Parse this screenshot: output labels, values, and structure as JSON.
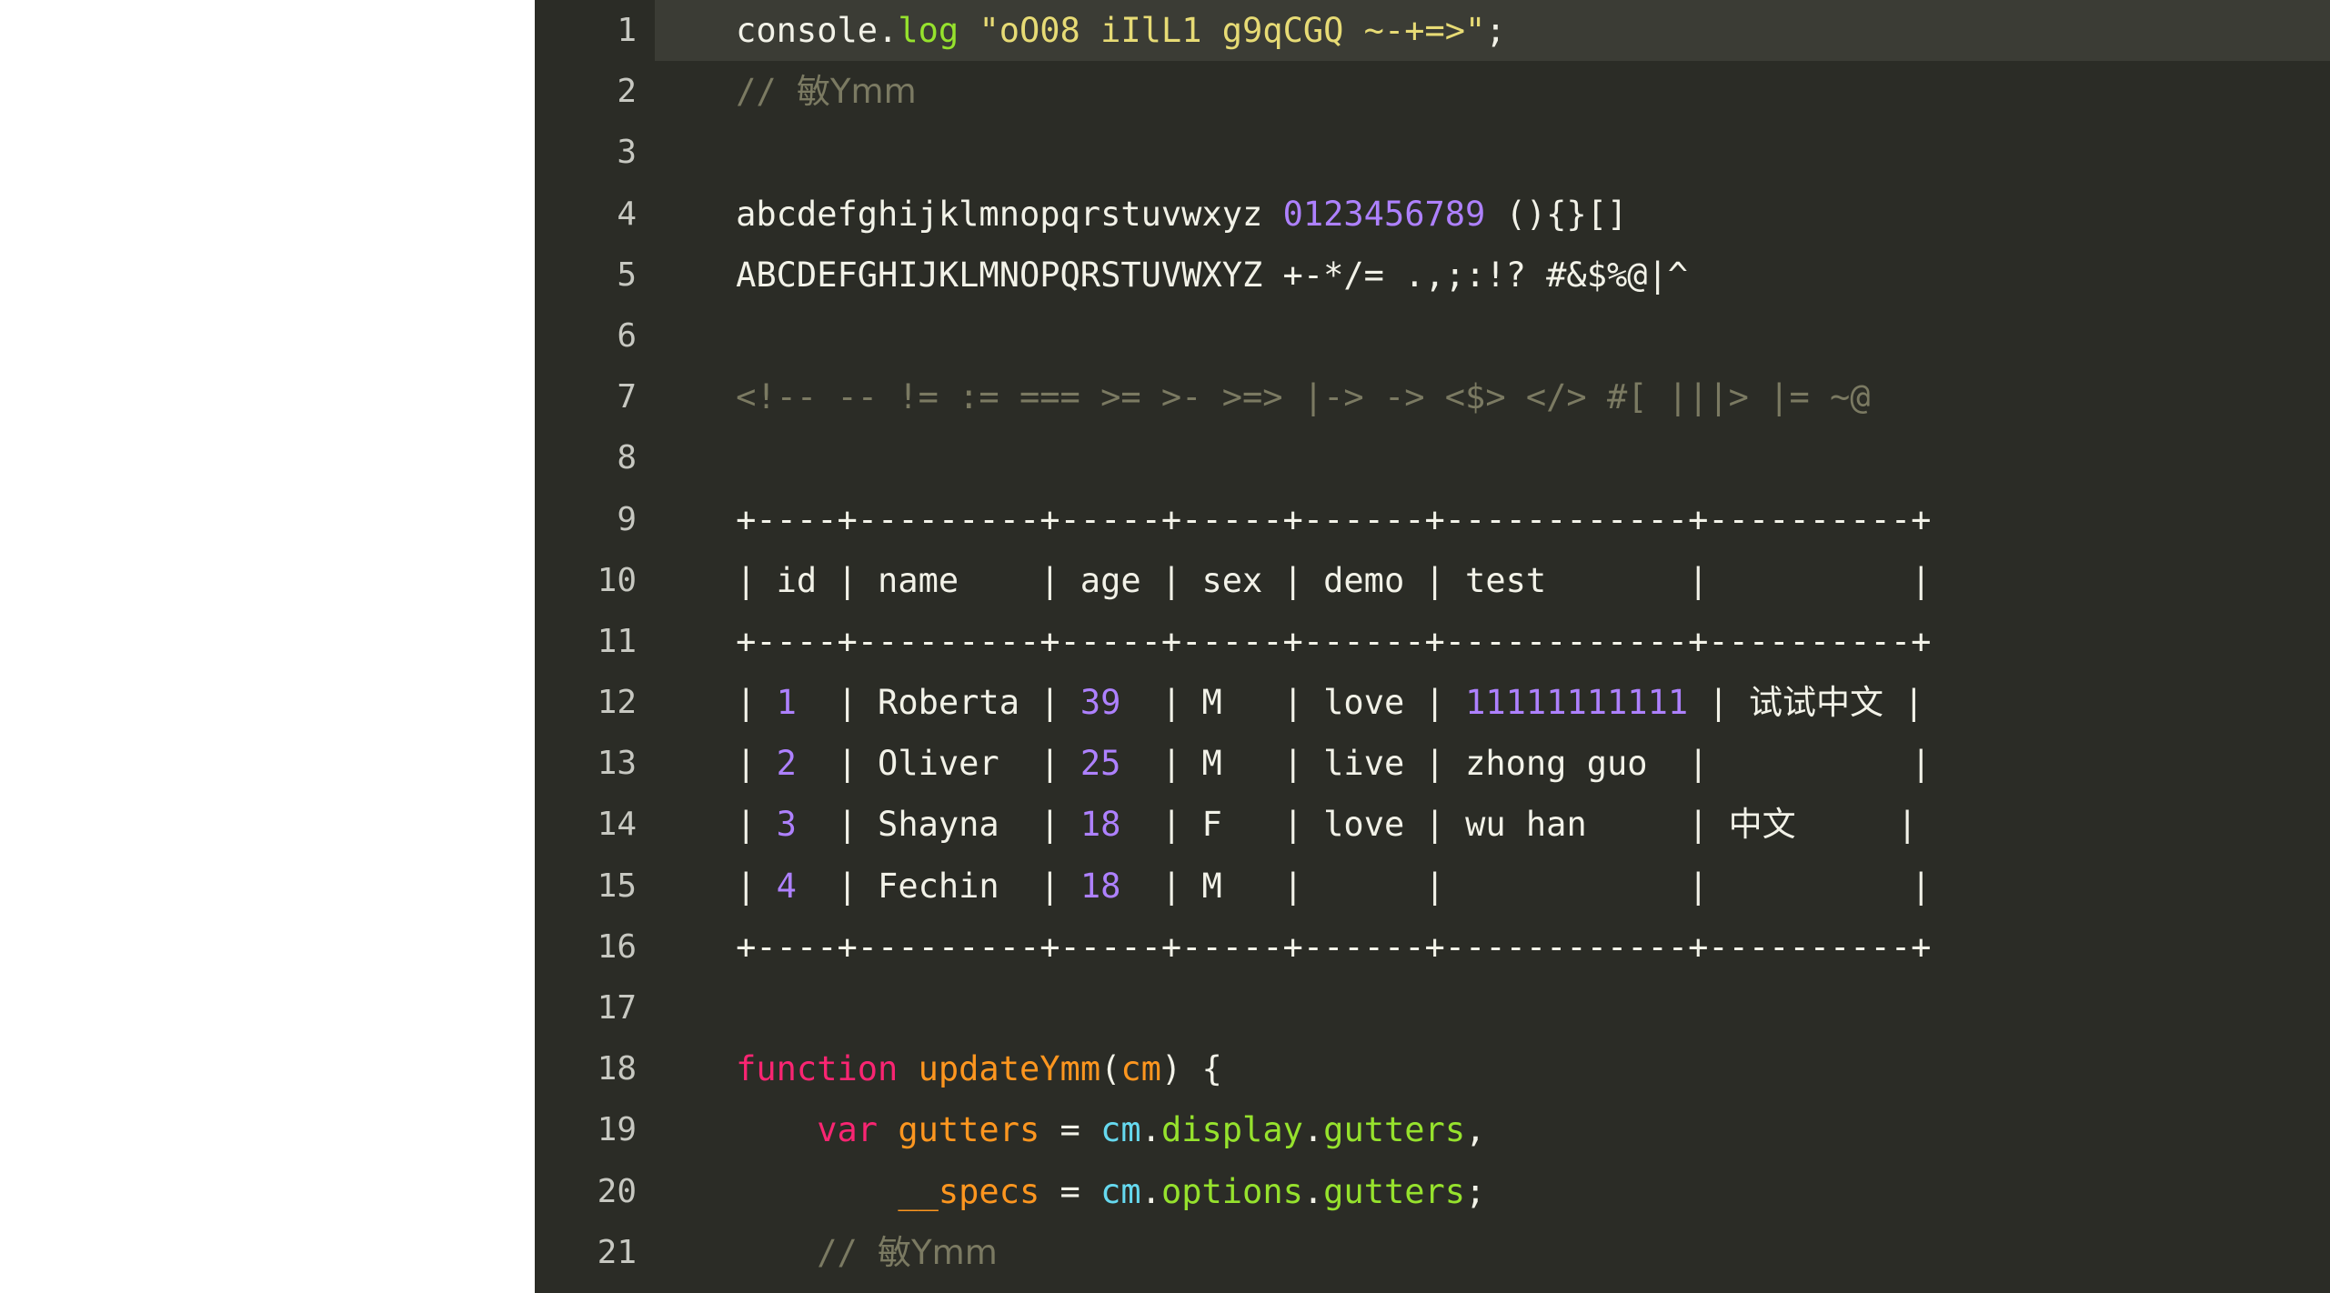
{
  "editor": {
    "theme_name": "monokai-dark",
    "background_color": "#2b2c26",
    "gutter_color": "#c7c8c1",
    "active_line_color": "#3b3c35",
    "foreground_color": "#f2f2e8",
    "accent_colors": {
      "keyword": "#f92572",
      "string": "#e7db75",
      "number": "#ae81ff",
      "property": "#96e22d",
      "function": "#fd961f",
      "parameter": "#66d9ef",
      "comment": "#7b7a62"
    },
    "active_line": 1,
    "total_lines": 21
  },
  "lines": [
    {
      "number": "1",
      "active": true,
      "tokens": [
        {
          "text": "    ",
          "cls": "t-plain"
        },
        {
          "text": "console",
          "cls": "t-plain"
        },
        {
          "text": ".",
          "cls": "t-punct"
        },
        {
          "text": "log",
          "cls": "t-prop"
        },
        {
          "text": " ",
          "cls": "t-plain"
        },
        {
          "text": "\"oO08 iIlL1 g9qCGQ ~-+=>\"",
          "cls": "t-string"
        },
        {
          "text": ";",
          "cls": "t-punct"
        }
      ]
    },
    {
      "number": "2",
      "active": false,
      "tokens": [
        {
          "text": "    ",
          "cls": "t-plain"
        },
        {
          "text": "// ",
          "cls": "t-comment"
        },
        {
          "text": "敏Ymm",
          "cls": "t-comment cjk"
        }
      ]
    },
    {
      "number": "3",
      "active": false,
      "tokens": []
    },
    {
      "number": "4",
      "active": false,
      "tokens": [
        {
          "text": "    ",
          "cls": "t-plain"
        },
        {
          "text": "abcdefghijklmnopqrstuvwxyz ",
          "cls": "t-plain"
        },
        {
          "text": "0123456789",
          "cls": "t-number"
        },
        {
          "text": " (){}[]",
          "cls": "t-plain"
        }
      ]
    },
    {
      "number": "5",
      "active": false,
      "tokens": [
        {
          "text": "    ",
          "cls": "t-plain"
        },
        {
          "text": "ABCDEFGHIJKLMNOPQRSTUVWXYZ +-*/= .,;:!? #&$%@|^",
          "cls": "t-plain"
        }
      ]
    },
    {
      "number": "6",
      "active": false,
      "tokens": []
    },
    {
      "number": "7",
      "active": false,
      "tokens": [
        {
          "text": "    ",
          "cls": "t-plain"
        },
        {
          "text": "<!-- -- != := === >= >- >=> |-> -> <$> </> #[ |||> |= ~@",
          "cls": "t-op"
        }
      ]
    },
    {
      "number": "8",
      "active": false,
      "tokens": []
    },
    {
      "number": "9",
      "active": false,
      "tokens": [
        {
          "text": "    ",
          "cls": "t-plain"
        },
        {
          "text": "+----+---------+-----+-----+------+------------+----------+",
          "cls": "t-plain"
        }
      ]
    },
    {
      "number": "10",
      "active": false,
      "tokens": [
        {
          "text": "    ",
          "cls": "t-plain"
        },
        {
          "text": "| id | name    | age | sex | demo | test       |          |",
          "cls": "t-plain"
        }
      ]
    },
    {
      "number": "11",
      "active": false,
      "tokens": [
        {
          "text": "    ",
          "cls": "t-plain"
        },
        {
          "text": "+----+---------+-----+-----+------+------------+----------+",
          "cls": "t-plain"
        }
      ]
    },
    {
      "number": "12",
      "active": false,
      "tokens": [
        {
          "text": "    ",
          "cls": "t-plain"
        },
        {
          "text": "| ",
          "cls": "t-plain"
        },
        {
          "text": "1",
          "cls": "t-number"
        },
        {
          "text": "  | Roberta | ",
          "cls": "t-plain"
        },
        {
          "text": "39",
          "cls": "t-number"
        },
        {
          "text": "  | M   | love | ",
          "cls": "t-plain"
        },
        {
          "text": "11111111111",
          "cls": "t-number"
        },
        {
          "text": " | ",
          "cls": "t-plain"
        },
        {
          "text": "试试中文",
          "cls": "t-plain cjk"
        },
        {
          "text": " |",
          "cls": "t-plain"
        }
      ]
    },
    {
      "number": "13",
      "active": false,
      "tokens": [
        {
          "text": "    ",
          "cls": "t-plain"
        },
        {
          "text": "| ",
          "cls": "t-plain"
        },
        {
          "text": "2",
          "cls": "t-number"
        },
        {
          "text": "  | Oliver  | ",
          "cls": "t-plain"
        },
        {
          "text": "25",
          "cls": "t-number"
        },
        {
          "text": "  | M   | live | zhong guo  |          |",
          "cls": "t-plain"
        }
      ]
    },
    {
      "number": "14",
      "active": false,
      "tokens": [
        {
          "text": "    ",
          "cls": "t-plain"
        },
        {
          "text": "| ",
          "cls": "t-plain"
        },
        {
          "text": "3",
          "cls": "t-number"
        },
        {
          "text": "  | Shayna  | ",
          "cls": "t-plain"
        },
        {
          "text": "18",
          "cls": "t-number"
        },
        {
          "text": "  | F   | love | wu han     | ",
          "cls": "t-plain"
        },
        {
          "text": "中文",
          "cls": "t-plain cjk"
        },
        {
          "text": "     |",
          "cls": "t-plain"
        }
      ]
    },
    {
      "number": "15",
      "active": false,
      "tokens": [
        {
          "text": "    ",
          "cls": "t-plain"
        },
        {
          "text": "| ",
          "cls": "t-plain"
        },
        {
          "text": "4",
          "cls": "t-number"
        },
        {
          "text": "  | Fechin  | ",
          "cls": "t-plain"
        },
        {
          "text": "18",
          "cls": "t-number"
        },
        {
          "text": "  | M   |      |            |          |",
          "cls": "t-plain"
        }
      ]
    },
    {
      "number": "16",
      "active": false,
      "tokens": [
        {
          "text": "    ",
          "cls": "t-plain"
        },
        {
          "text": "+----+---------+-----+-----+------+------------+----------+",
          "cls": "t-plain"
        }
      ]
    },
    {
      "number": "17",
      "active": false,
      "tokens": []
    },
    {
      "number": "18",
      "active": false,
      "tokens": [
        {
          "text": "    ",
          "cls": "t-plain"
        },
        {
          "text": "function",
          "cls": "t-kw"
        },
        {
          "text": " ",
          "cls": "t-plain"
        },
        {
          "text": "updateYmm",
          "cls": "t-func"
        },
        {
          "text": "(",
          "cls": "t-punct"
        },
        {
          "text": "cm",
          "cls": "t-func"
        },
        {
          "text": ") {",
          "cls": "t-punct"
        }
      ]
    },
    {
      "number": "19",
      "active": false,
      "tokens": [
        {
          "text": "        ",
          "cls": "t-plain"
        },
        {
          "text": "var",
          "cls": "t-kw"
        },
        {
          "text": " ",
          "cls": "t-plain"
        },
        {
          "text": "gutters",
          "cls": "t-var"
        },
        {
          "text": " ",
          "cls": "t-plain"
        },
        {
          "text": "=",
          "cls": "t-punct"
        },
        {
          "text": " ",
          "cls": "t-plain"
        },
        {
          "text": "cm",
          "cls": "t-param"
        },
        {
          "text": ".",
          "cls": "t-punct"
        },
        {
          "text": "display",
          "cls": "t-prop"
        },
        {
          "text": ".",
          "cls": "t-punct"
        },
        {
          "text": "gutters",
          "cls": "t-prop"
        },
        {
          "text": ",",
          "cls": "t-punct"
        }
      ]
    },
    {
      "number": "20",
      "active": false,
      "tokens": [
        {
          "text": "            ",
          "cls": "t-plain"
        },
        {
          "text": "__specs",
          "cls": "t-var"
        },
        {
          "text": " ",
          "cls": "t-plain"
        },
        {
          "text": "=",
          "cls": "t-punct"
        },
        {
          "text": " ",
          "cls": "t-plain"
        },
        {
          "text": "cm",
          "cls": "t-param"
        },
        {
          "text": ".",
          "cls": "t-punct"
        },
        {
          "text": "options",
          "cls": "t-prop"
        },
        {
          "text": ".",
          "cls": "t-punct"
        },
        {
          "text": "gutters",
          "cls": "t-prop"
        },
        {
          "text": ";",
          "cls": "t-punct"
        }
      ]
    },
    {
      "number": "21",
      "active": false,
      "tokens": [
        {
          "text": "        ",
          "cls": "t-plain"
        },
        {
          "text": "// ",
          "cls": "t-comment"
        },
        {
          "text": "敏Ymm",
          "cls": "t-comment cjk"
        }
      ]
    }
  ],
  "table_preview": {
    "columns": [
      "id",
      "name",
      "age",
      "sex",
      "demo",
      "test",
      ""
    ],
    "rows": [
      [
        "1",
        "Roberta",
        "39",
        "M",
        "love",
        "11111111111",
        "试试中文"
      ],
      [
        "2",
        "Oliver",
        "25",
        "M",
        "live",
        "zhong guo",
        ""
      ],
      [
        "3",
        "Shayna",
        "18",
        "F",
        "love",
        "wu han",
        "中文"
      ],
      [
        "4",
        "Fechin",
        "18",
        "M",
        "",
        "",
        ""
      ]
    ]
  }
}
